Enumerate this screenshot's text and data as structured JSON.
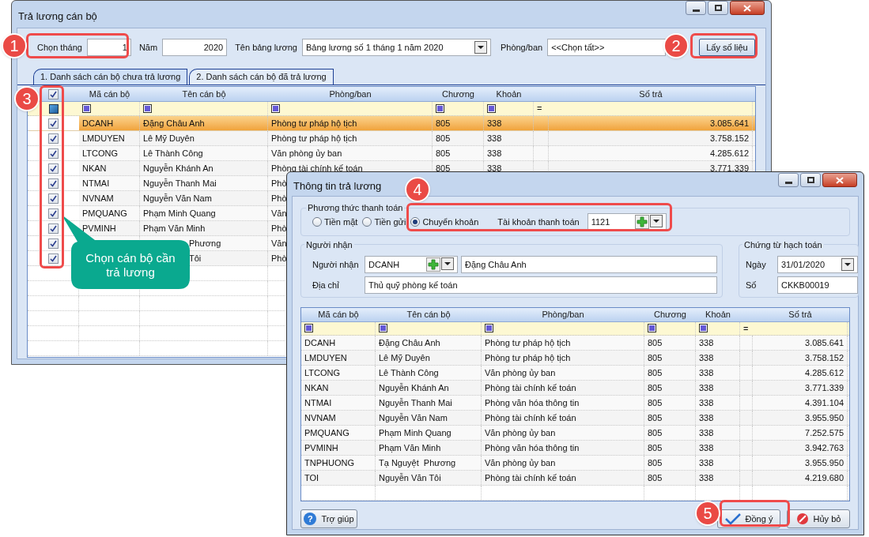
{
  "main_window": {
    "title": "Trả lương cán bộ",
    "filters": {
      "month_label": "Chọn tháng",
      "month": "1",
      "year_label": "Năm",
      "year": "2020",
      "table_label": "Tên bảng lương",
      "table": "Bảng lương số 1 tháng 1 năm 2020",
      "dept_label": "Phòng/ban",
      "dept": "<<Chọn tất>>"
    },
    "fetch_button": "Lấy số liệu",
    "tabs": [
      {
        "label": "1. Danh sách cán bộ chưa trả lương",
        "selected": true
      },
      {
        "label": "2. Danh sách cán bộ đã trả lương",
        "selected": false
      }
    ],
    "grid": {
      "all_checked": true,
      "columns": [
        "Mã cán bộ",
        "Tên cán bộ",
        "Phòng/ban",
        "Chương",
        "Khoản",
        "Số trả"
      ],
      "filter_operator": "=",
      "rows": [
        {
          "checked": true,
          "selected": true,
          "cells": [
            "DCANH",
            "Đặng Châu Anh",
            "Phòng tư pháp hộ tịch",
            "805",
            "338",
            "3.085.641"
          ]
        },
        {
          "checked": true,
          "selected": false,
          "cells": [
            "LMDUYEN",
            "Lê Mỹ Duyên",
            "Phòng tư pháp hộ tịch",
            "805",
            "338",
            "3.758.152"
          ]
        },
        {
          "checked": true,
          "selected": false,
          "cells": [
            "LTCONG",
            "Lê Thành Công",
            "Văn phòng ủy ban",
            "805",
            "338",
            "4.285.612"
          ]
        },
        {
          "checked": true,
          "selected": false,
          "cells": [
            "NKAN",
            "Nguyễn Khánh An",
            "Phòng tài chính kế toán",
            "805",
            "338",
            "3.771.339"
          ]
        },
        {
          "checked": true,
          "selected": false,
          "cells": [
            "NTMAI",
            "Nguyễn Thanh Mai",
            "Phò"
          ]
        },
        {
          "checked": true,
          "selected": false,
          "cells": [
            "NVNAM",
            "Nguyễn Văn Nam",
            "Phò"
          ]
        },
        {
          "checked": true,
          "selected": false,
          "cells": [
            "PMQUANG",
            "Phạm Minh Quang",
            "Văn"
          ]
        },
        {
          "checked": true,
          "selected": false,
          "cells": [
            "PVMINH",
            "Phạm Văn Minh",
            "Phò"
          ]
        },
        {
          "checked": true,
          "selected": false,
          "cells": [
            null,
            "Phương",
            "Văn"
          ]
        },
        {
          "checked": true,
          "selected": false,
          "cells": [
            null,
            "Tôi",
            "Phò"
          ]
        }
      ]
    }
  },
  "callout": "Chọn cán bộ cần trả lương",
  "badges": [
    "1",
    "2",
    "3",
    "4",
    "5"
  ],
  "dialog": {
    "title": "Thông tin trả lương",
    "payment_group": "Phương thức thanh toán",
    "methods": [
      {
        "label": "Tiền mặt",
        "selected": false
      },
      {
        "label": "Tiền gửi",
        "selected": false
      },
      {
        "label": "Chuyển khoản",
        "selected": true
      }
    ],
    "account_label": "Tài khoản thanh toán",
    "account": "1121",
    "recipient_group": "Người nhận",
    "recipient_label": "Người nhận",
    "recipient_code": "DCANH",
    "recipient_name": "Đặng Châu Anh",
    "address_label": "Địa chỉ",
    "address": "Thủ quỹ phòng kế toán",
    "voucher_group": "Chứng từ hạch toán",
    "date_label": "Ngày",
    "date": "31/01/2020",
    "number_label": "Số",
    "number": "CKKB00019",
    "grid": {
      "columns": [
        "Mã cán bộ",
        "Tên cán bộ",
        "Phòng/ban",
        "Chương",
        "Khoản",
        "Số trả"
      ],
      "filter_operator": "=",
      "rows": [
        [
          "DCANH",
          "Đặng Châu Anh",
          "Phòng tư pháp hộ tịch",
          "805",
          "338",
          "3.085.641"
        ],
        [
          "LMDUYEN",
          "Lê Mỹ Duyên",
          "Phòng tư pháp hộ tịch",
          "805",
          "338",
          "3.758.152"
        ],
        [
          "LTCONG",
          "Lê Thành Công",
          "Văn phòng ủy ban",
          "805",
          "338",
          "4.285.612"
        ],
        [
          "NKAN",
          "Nguyễn Khánh An",
          "Phòng tài chính kế toán",
          "805",
          "338",
          "3.771.339"
        ],
        [
          "NTMAI",
          "Nguyễn Thanh Mai",
          "Phòng văn hóa thông tin",
          "805",
          "338",
          "4.391.104"
        ],
        [
          "NVNAM",
          "Nguyễn Văn Nam",
          "Phòng tài chính kế toán",
          "805",
          "338",
          "3.955.950"
        ],
        [
          "PMQUANG",
          "Phạm Minh Quang",
          "Văn phòng ủy ban",
          "805",
          "338",
          "7.252.575"
        ],
        [
          "PVMINH",
          "Phạm Văn Minh",
          "Phòng văn hóa thông tin",
          "805",
          "338",
          "3.942.763"
        ],
        [
          "TNPHUONG",
          "Tạ Nguyệt  Phương",
          "Văn phòng ủy ban",
          "805",
          "338",
          "3.955.950"
        ],
        [
          "TOI",
          "Nguyễn Văn Tôi",
          "Phòng tài chính kế toán",
          "805",
          "338",
          "4.219.680"
        ]
      ]
    },
    "buttons": [
      {
        "label": "Trợ giúp",
        "kind": "help",
        "icon": "?"
      },
      {
        "label": "Đồng ý",
        "kind": "ok"
      },
      {
        "label": "Hủy bỏ",
        "kind": "cancel"
      }
    ]
  }
}
